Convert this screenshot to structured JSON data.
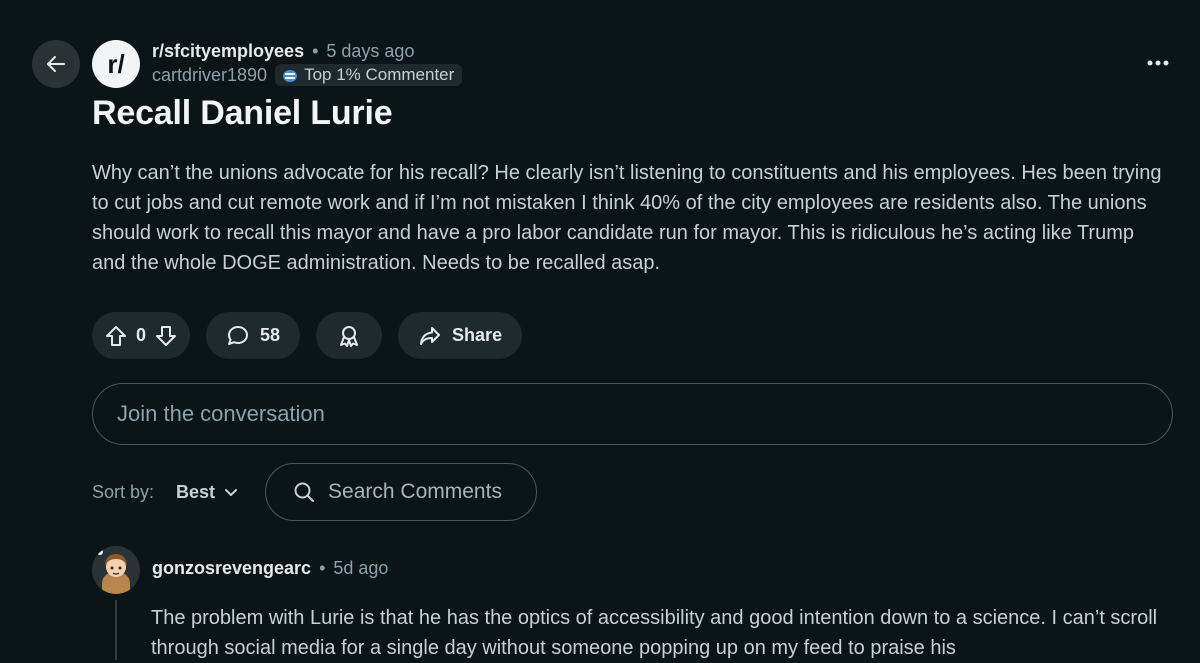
{
  "post": {
    "subreddit": "r/sfcityemployees",
    "subreddit_icon_text": "r/",
    "separator": "•",
    "time": "5 days ago",
    "author": "cartdriver1890",
    "badge": "Top 1% Commenter",
    "title": "Recall Daniel Lurie",
    "body": "Why can’t the unions advocate for his recall? He clearly isn’t listening to constituents and his employees. Hes been trying to cut jobs and cut remote work and if I’m not mistaken I think 40% of the city employees are residents also. The unions should work to recall this mayor and have a pro labor candidate run for mayor. This is ridiculous he’s acting like Trump and the whole DOGE administration. Needs to be recalled asap.",
    "votes": "0",
    "comments_count": "58",
    "share_label": "Share"
  },
  "composer": {
    "placeholder": "Join the conversation"
  },
  "sort": {
    "label": "Sort by:",
    "value": "Best",
    "search_placeholder": "Search Comments"
  },
  "comment": {
    "author": "gonzosrevengearc",
    "separator": "•",
    "time": "5d ago",
    "body": "The problem with Lurie is that he has the optics of accessibility and good intention down to a science. I can’t scroll through social media for a single day without someone popping up on my feed to praise his"
  },
  "icons": {
    "back": "arrow-left-icon",
    "more": "more-horizontal-icon",
    "upvote": "upvote-icon",
    "downvote": "downvote-icon",
    "comment": "comment-bubble-icon",
    "award": "award-icon",
    "share": "share-arrow-icon",
    "chevron": "chevron-down-icon",
    "search": "search-icon"
  },
  "colors": {
    "background": "#0b1416",
    "surface": "#1f2a2e",
    "text": "#d7dadc",
    "muted": "#8ba2ad"
  }
}
